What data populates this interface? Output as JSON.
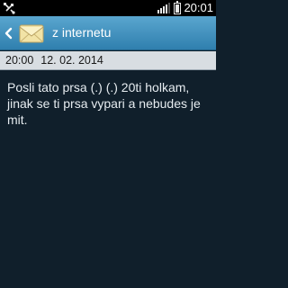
{
  "status_bar": {
    "time": "20:01",
    "battery_level": 0.95,
    "signal_bars": 4
  },
  "header": {
    "title": "z internetu"
  },
  "message": {
    "time": "20:00",
    "date": "12. 02. 2014",
    "text": "Posli tato prsa (.) (.) 20ti holkam, jinak se ti prsa vypari a nebudes je mit."
  },
  "colors": {
    "background": "#101f2b",
    "header_gradient_top": "#5aa6cf",
    "header_gradient_bottom": "#2f7fae",
    "meta_bar": "#d8dde2"
  }
}
